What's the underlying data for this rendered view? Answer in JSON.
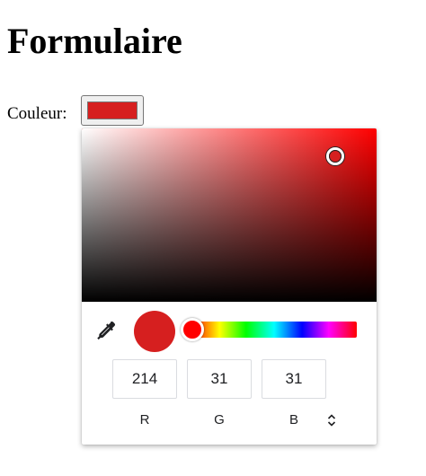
{
  "page": {
    "title": "Formulaire",
    "color_label": "Couleur:"
  },
  "color_input": {
    "value_hex": "#d61f1f"
  },
  "picker": {
    "selected_color": {
      "r": 214,
      "g": 31,
      "b": 31,
      "hex": "#d61f1f"
    },
    "hue_color": "#ff0000",
    "hue_degrees": 0,
    "saturation": 0.86,
    "value": 0.84,
    "channels": [
      {
        "label": "R",
        "value": "214"
      },
      {
        "label": "G",
        "value": "31"
      },
      {
        "label": "B",
        "value": "31"
      }
    ],
    "icons": {
      "eyedropper": "eyedropper-icon",
      "format_toggle": "up-down-chevron-icon"
    }
  }
}
